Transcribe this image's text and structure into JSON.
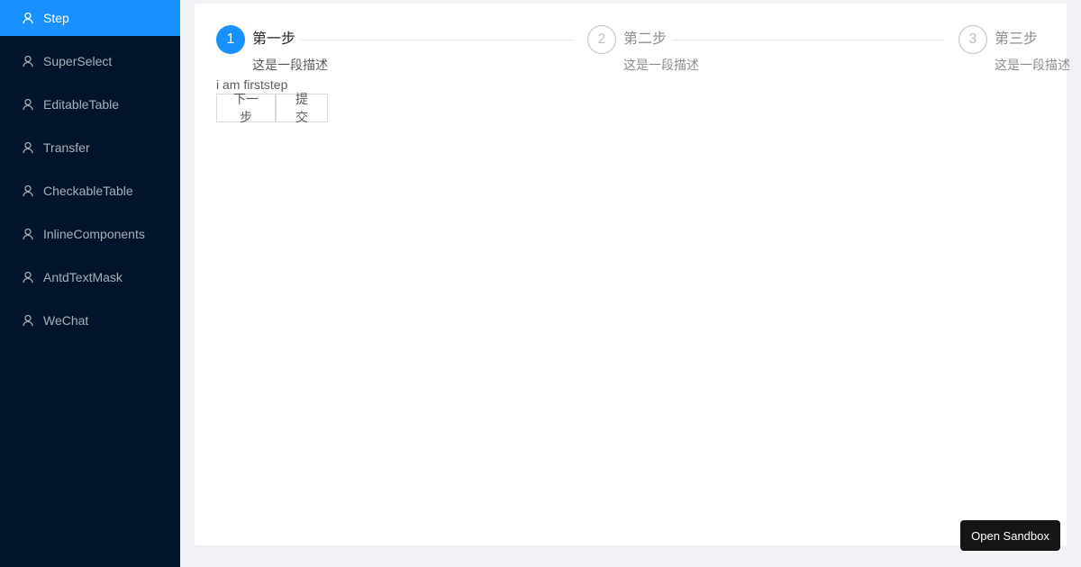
{
  "sidebar": {
    "items": [
      {
        "label": "Step",
        "icon": "user-icon",
        "active": true
      },
      {
        "label": "SuperSelect",
        "icon": "user-icon"
      },
      {
        "label": "EditableTable",
        "icon": "user-icon"
      },
      {
        "label": "Transfer",
        "icon": "user-icon"
      },
      {
        "label": "CheckableTable",
        "icon": "user-icon"
      },
      {
        "label": "InlineComponents",
        "icon": "user-icon"
      },
      {
        "label": "AntdTextMask",
        "icon": "user-icon"
      },
      {
        "label": "WeChat",
        "icon": "user-icon"
      }
    ]
  },
  "steps": [
    {
      "number": "1",
      "title": "第一步",
      "description": "这是一段描述",
      "status": "process"
    },
    {
      "number": "2",
      "title": "第二步",
      "description": "这是一段描述",
      "status": "wait"
    },
    {
      "number": "3",
      "title": "第三步",
      "description": "这是一段描述",
      "status": "wait"
    }
  ],
  "step_content": "i am firststep",
  "buttons": {
    "next_label": "下一步",
    "submit_label": "提 交"
  },
  "sandbox": {
    "label": "Open Sandbox"
  },
  "colors": {
    "sidebar_bg": "#001529",
    "accent": "#1890ff",
    "page_bg": "#f0f2f5"
  }
}
